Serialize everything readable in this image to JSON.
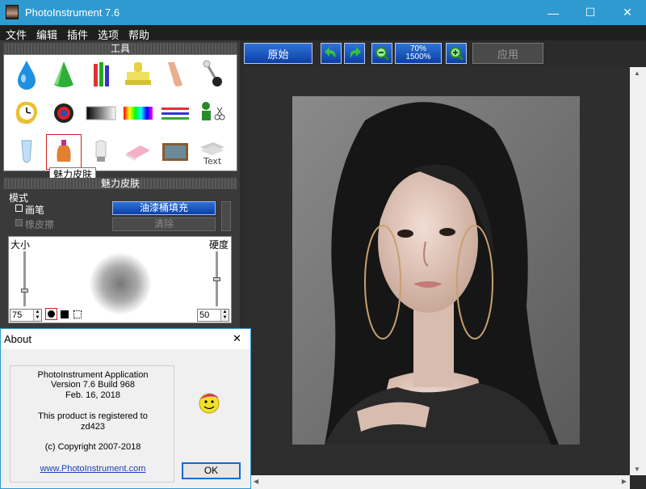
{
  "window": {
    "title": "PhotoInstrument 7.6",
    "minimize": "—",
    "maximize": "☐",
    "close": "✕"
  },
  "menu": [
    "文件",
    "编辑",
    "插件",
    "选项",
    "帮助"
  ],
  "tools_panel": {
    "header": "工具"
  },
  "tooltip": "魅力皮肤",
  "settings_panel": {
    "header": "魅力皮肤",
    "mode_label": "模式",
    "pencil_label": "画笔",
    "eraser_label": "橡皮擦",
    "fill_button": "油漆桶填充",
    "clear_button": "清除",
    "size_label": "大小",
    "hardness_label": "硬度",
    "size_value": "75",
    "hardness_value": "50"
  },
  "toolbar": {
    "original_button": "原始",
    "zoom_top": "70%",
    "zoom_bottom": "1500%",
    "apply_button": "应用"
  },
  "about_dialog": {
    "title": "About",
    "close": "✕",
    "line1": "PhotoInstrument Application",
    "line2": "Version 7.6 Build 968",
    "line3": "Feb. 16, 2018",
    "line4": "This product is registered to",
    "line5": "zd423",
    "line6": "(c) Copyright 2007-2018",
    "link": "www.PhotoInstrument.com",
    "ok_button": "OK"
  },
  "colors": {
    "titlebar": "#2f9ad0",
    "accent_blue": "#0b3fa6"
  }
}
